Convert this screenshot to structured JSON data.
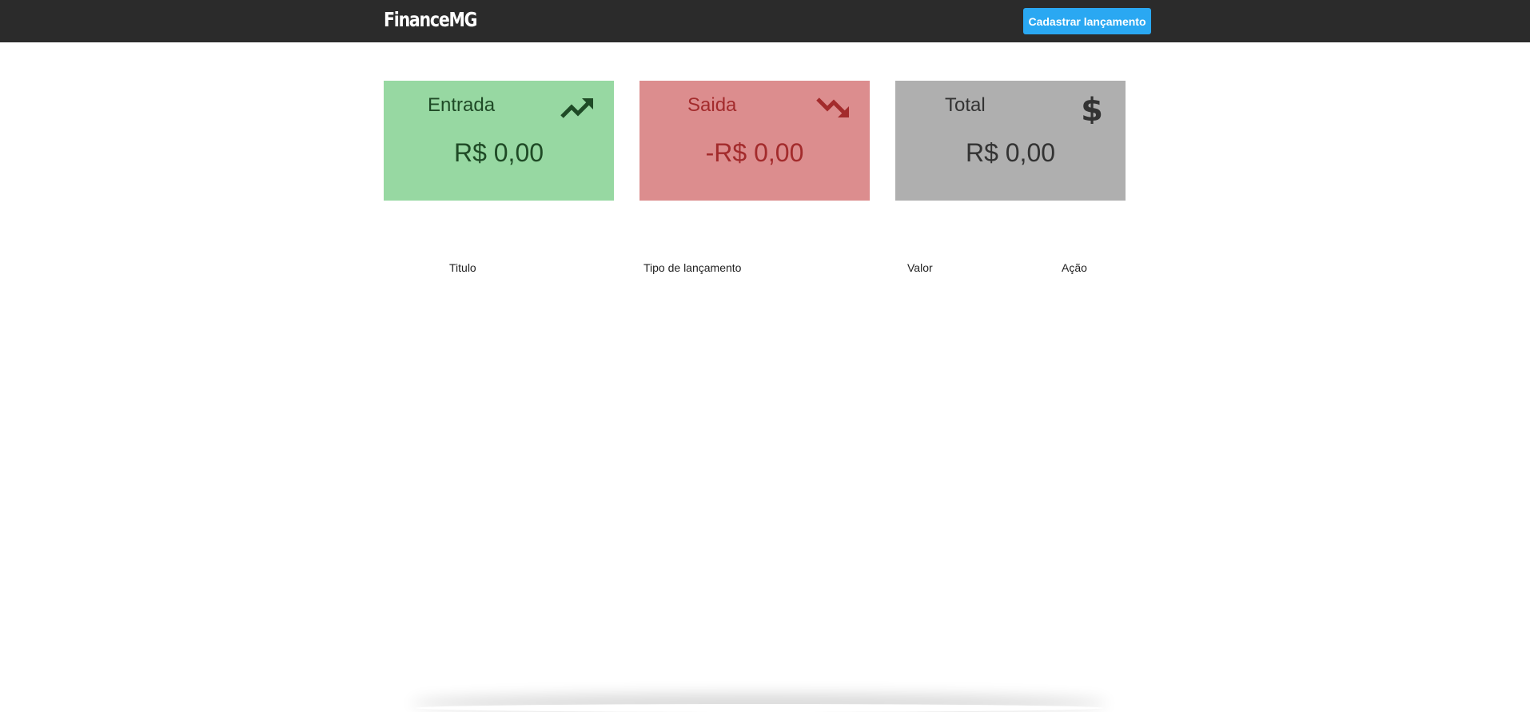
{
  "header": {
    "brand": "FinanceMG",
    "new_entry_button": "Cadastrar lançamento"
  },
  "summary": {
    "income": {
      "label": "Entrada",
      "value": "R$ 0,00",
      "icon": "trending-up-icon"
    },
    "expense": {
      "label": "Saida",
      "value": "-R$ 0,00",
      "icon": "trending-down-icon"
    },
    "total": {
      "label": "Total",
      "value": "R$ 0,00",
      "icon": "dollar-icon"
    }
  },
  "table": {
    "columns": [
      "Titulo",
      "Tipo de lançamento",
      "Valor",
      "Ação"
    ],
    "rows": []
  },
  "colors": {
    "topbar": "#2b2b2b",
    "button": "#2aa8f2",
    "income_bg": "#97d8a2",
    "expense_bg": "#dc8d8e",
    "total_bg": "#afafaf"
  }
}
